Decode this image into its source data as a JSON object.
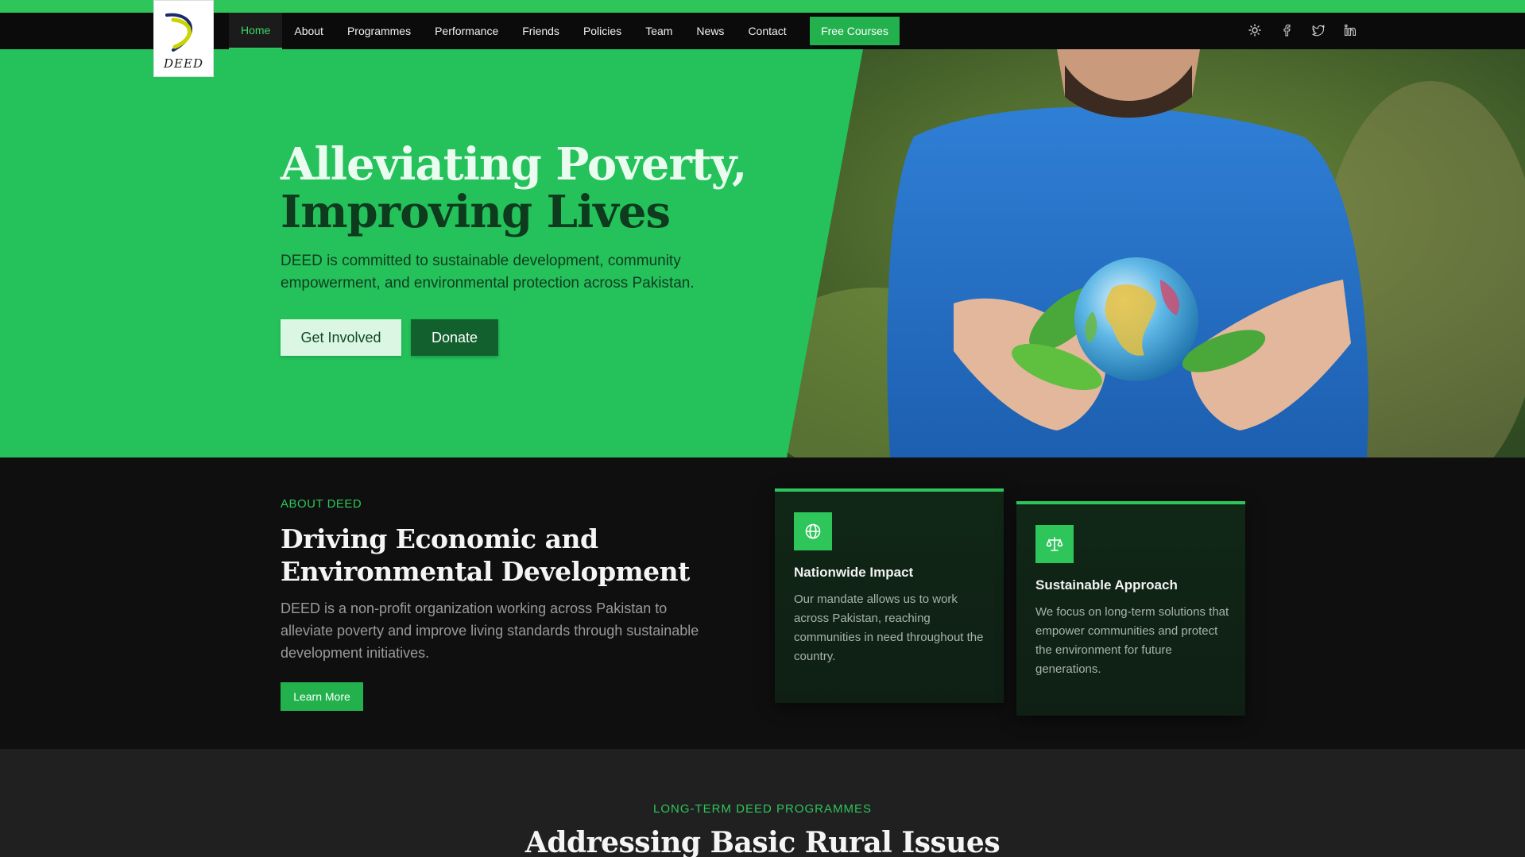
{
  "brand": {
    "logo_text": "DEED"
  },
  "nav": {
    "items": [
      {
        "label": "Home",
        "active": true
      },
      {
        "label": "About"
      },
      {
        "label": "Programmes"
      },
      {
        "label": "Performance"
      },
      {
        "label": "Friends"
      },
      {
        "label": "Policies"
      },
      {
        "label": "Team"
      },
      {
        "label": "News"
      },
      {
        "label": "Contact"
      }
    ],
    "cta_label": "Free Courses",
    "icons": [
      "sun-icon",
      "facebook-icon",
      "twitter-icon",
      "linkedin-icon"
    ]
  },
  "hero": {
    "title_line1": "Alleviating Poverty,",
    "title_line2": "Improving Lives",
    "subtitle": "DEED is committed to sustainable development, community empowerment, and environmental protection across Pakistan.",
    "primary_button": "Get Involved",
    "secondary_button": "Donate"
  },
  "about": {
    "kicker": "ABOUT DEED",
    "title": "Driving Economic and Environmental Development",
    "text": "DEED is a non-profit organization working across Pakistan to alleviate poverty and improve living standards through sustainable development initiatives.",
    "button": "Learn More",
    "cards": [
      {
        "icon": "globe-icon",
        "title": "Nationwide Impact",
        "text": "Our mandate allows us to work across Pakistan, reaching communities in need throughout the country."
      },
      {
        "icon": "scale-icon",
        "title": "Sustainable Approach",
        "text": "We focus on long-term solutions that empower communities and protect the environment for future generations."
      }
    ]
  },
  "programmes": {
    "kicker": "LONG-TERM DEED PROGRAMMES",
    "title": "Addressing Basic Rural Issues"
  },
  "colors": {
    "accent": "#2ec55a",
    "hero_green": "#25c15b",
    "dark_green": "#13602f",
    "background": "#0f0f10"
  }
}
